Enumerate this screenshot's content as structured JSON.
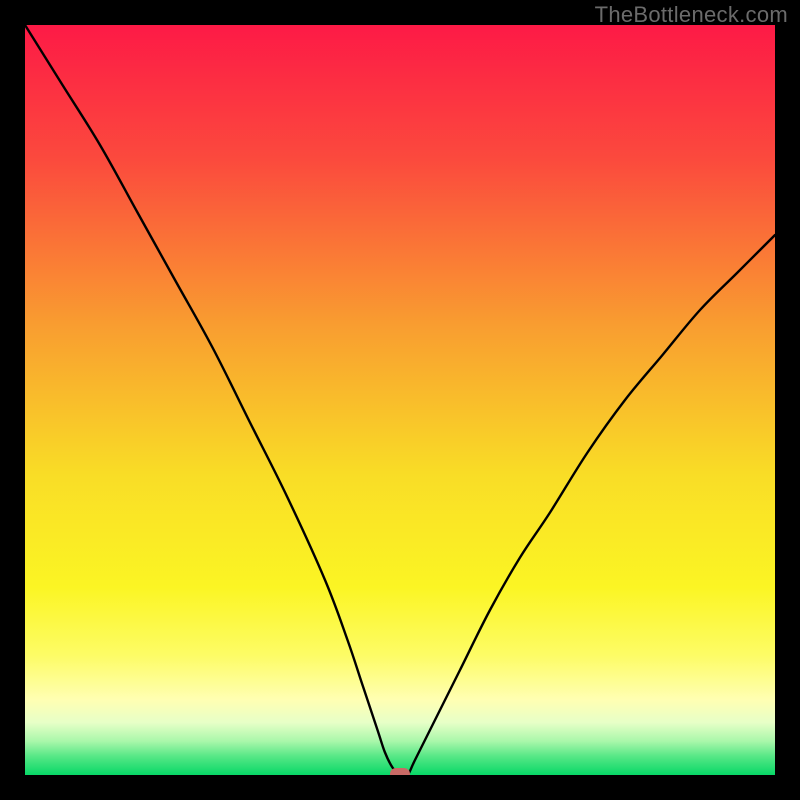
{
  "watermark": "TheBottleneck.com",
  "chart_data": {
    "type": "line",
    "title": "",
    "xlabel": "",
    "ylabel": "",
    "xlim": [
      0,
      100
    ],
    "ylim": [
      0,
      100
    ],
    "grid": false,
    "legend": false,
    "series": [
      {
        "name": "bottleneck-curve",
        "x": [
          0,
          5,
          10,
          15,
          20,
          25,
          30,
          35,
          40,
          43,
          45,
          47,
          48,
          49,
          50,
          51,
          52,
          55,
          58,
          62,
          66,
          70,
          75,
          80,
          85,
          90,
          95,
          100
        ],
        "y": [
          100,
          92,
          84,
          75,
          66,
          57,
          47,
          37,
          26,
          18,
          12,
          6,
          3,
          1,
          0,
          0,
          2,
          8,
          14,
          22,
          29,
          35,
          43,
          50,
          56,
          62,
          67,
          72
        ]
      }
    ],
    "marker": {
      "x": 50,
      "y": 0,
      "color": "#c96a66"
    },
    "background_gradient": {
      "stops": [
        {
          "offset": 0.0,
          "color": "#fd1a46"
        },
        {
          "offset": 0.18,
          "color": "#fb4a3d"
        },
        {
          "offset": 0.4,
          "color": "#f99d30"
        },
        {
          "offset": 0.6,
          "color": "#f9dd26"
        },
        {
          "offset": 0.75,
          "color": "#fbf524"
        },
        {
          "offset": 0.84,
          "color": "#fdfc65"
        },
        {
          "offset": 0.9,
          "color": "#ffffb3"
        },
        {
          "offset": 0.93,
          "color": "#e7ffc7"
        },
        {
          "offset": 0.955,
          "color": "#a9f7aa"
        },
        {
          "offset": 0.975,
          "color": "#57e786"
        },
        {
          "offset": 1.0,
          "color": "#08d867"
        }
      ]
    }
  }
}
